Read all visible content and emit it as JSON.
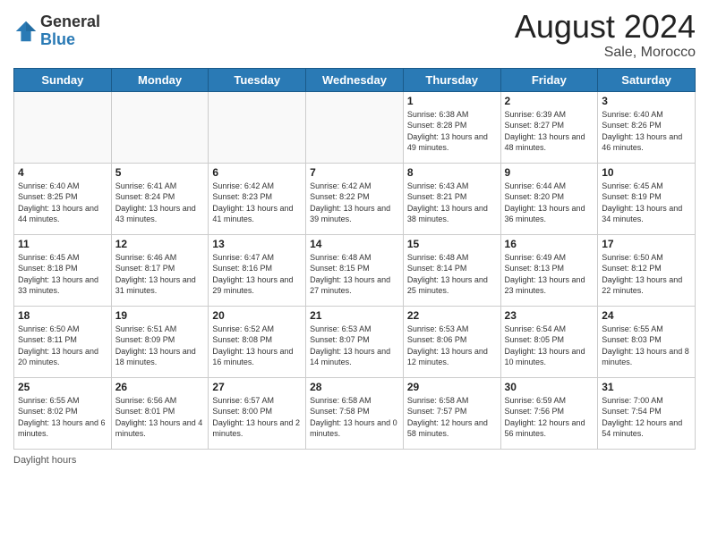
{
  "header": {
    "logo_general": "General",
    "logo_blue": "Blue",
    "month_year": "August 2024",
    "location": "Sale, Morocco"
  },
  "days_of_week": [
    "Sunday",
    "Monday",
    "Tuesday",
    "Wednesday",
    "Thursday",
    "Friday",
    "Saturday"
  ],
  "footer_text": "Daylight hours",
  "weeks": [
    [
      {
        "day": "",
        "info": ""
      },
      {
        "day": "",
        "info": ""
      },
      {
        "day": "",
        "info": ""
      },
      {
        "day": "",
        "info": ""
      },
      {
        "day": "1",
        "info": "Sunrise: 6:38 AM\nSunset: 8:28 PM\nDaylight: 13 hours\nand 49 minutes."
      },
      {
        "day": "2",
        "info": "Sunrise: 6:39 AM\nSunset: 8:27 PM\nDaylight: 13 hours\nand 48 minutes."
      },
      {
        "day": "3",
        "info": "Sunrise: 6:40 AM\nSunset: 8:26 PM\nDaylight: 13 hours\nand 46 minutes."
      }
    ],
    [
      {
        "day": "4",
        "info": "Sunrise: 6:40 AM\nSunset: 8:25 PM\nDaylight: 13 hours\nand 44 minutes."
      },
      {
        "day": "5",
        "info": "Sunrise: 6:41 AM\nSunset: 8:24 PM\nDaylight: 13 hours\nand 43 minutes."
      },
      {
        "day": "6",
        "info": "Sunrise: 6:42 AM\nSunset: 8:23 PM\nDaylight: 13 hours\nand 41 minutes."
      },
      {
        "day": "7",
        "info": "Sunrise: 6:42 AM\nSunset: 8:22 PM\nDaylight: 13 hours\nand 39 minutes."
      },
      {
        "day": "8",
        "info": "Sunrise: 6:43 AM\nSunset: 8:21 PM\nDaylight: 13 hours\nand 38 minutes."
      },
      {
        "day": "9",
        "info": "Sunrise: 6:44 AM\nSunset: 8:20 PM\nDaylight: 13 hours\nand 36 minutes."
      },
      {
        "day": "10",
        "info": "Sunrise: 6:45 AM\nSunset: 8:19 PM\nDaylight: 13 hours\nand 34 minutes."
      }
    ],
    [
      {
        "day": "11",
        "info": "Sunrise: 6:45 AM\nSunset: 8:18 PM\nDaylight: 13 hours\nand 33 minutes."
      },
      {
        "day": "12",
        "info": "Sunrise: 6:46 AM\nSunset: 8:17 PM\nDaylight: 13 hours\nand 31 minutes."
      },
      {
        "day": "13",
        "info": "Sunrise: 6:47 AM\nSunset: 8:16 PM\nDaylight: 13 hours\nand 29 minutes."
      },
      {
        "day": "14",
        "info": "Sunrise: 6:48 AM\nSunset: 8:15 PM\nDaylight: 13 hours\nand 27 minutes."
      },
      {
        "day": "15",
        "info": "Sunrise: 6:48 AM\nSunset: 8:14 PM\nDaylight: 13 hours\nand 25 minutes."
      },
      {
        "day": "16",
        "info": "Sunrise: 6:49 AM\nSunset: 8:13 PM\nDaylight: 13 hours\nand 23 minutes."
      },
      {
        "day": "17",
        "info": "Sunrise: 6:50 AM\nSunset: 8:12 PM\nDaylight: 13 hours\nand 22 minutes."
      }
    ],
    [
      {
        "day": "18",
        "info": "Sunrise: 6:50 AM\nSunset: 8:11 PM\nDaylight: 13 hours\nand 20 minutes."
      },
      {
        "day": "19",
        "info": "Sunrise: 6:51 AM\nSunset: 8:09 PM\nDaylight: 13 hours\nand 18 minutes."
      },
      {
        "day": "20",
        "info": "Sunrise: 6:52 AM\nSunset: 8:08 PM\nDaylight: 13 hours\nand 16 minutes."
      },
      {
        "day": "21",
        "info": "Sunrise: 6:53 AM\nSunset: 8:07 PM\nDaylight: 13 hours\nand 14 minutes."
      },
      {
        "day": "22",
        "info": "Sunrise: 6:53 AM\nSunset: 8:06 PM\nDaylight: 13 hours\nand 12 minutes."
      },
      {
        "day": "23",
        "info": "Sunrise: 6:54 AM\nSunset: 8:05 PM\nDaylight: 13 hours\nand 10 minutes."
      },
      {
        "day": "24",
        "info": "Sunrise: 6:55 AM\nSunset: 8:03 PM\nDaylight: 13 hours\nand 8 minutes."
      }
    ],
    [
      {
        "day": "25",
        "info": "Sunrise: 6:55 AM\nSunset: 8:02 PM\nDaylight: 13 hours\nand 6 minutes."
      },
      {
        "day": "26",
        "info": "Sunrise: 6:56 AM\nSunset: 8:01 PM\nDaylight: 13 hours\nand 4 minutes."
      },
      {
        "day": "27",
        "info": "Sunrise: 6:57 AM\nSunset: 8:00 PM\nDaylight: 13 hours\nand 2 minutes."
      },
      {
        "day": "28",
        "info": "Sunrise: 6:58 AM\nSunset: 7:58 PM\nDaylight: 13 hours\nand 0 minutes."
      },
      {
        "day": "29",
        "info": "Sunrise: 6:58 AM\nSunset: 7:57 PM\nDaylight: 12 hours\nand 58 minutes."
      },
      {
        "day": "30",
        "info": "Sunrise: 6:59 AM\nSunset: 7:56 PM\nDaylight: 12 hours\nand 56 minutes."
      },
      {
        "day": "31",
        "info": "Sunrise: 7:00 AM\nSunset: 7:54 PM\nDaylight: 12 hours\nand 54 minutes."
      }
    ]
  ]
}
